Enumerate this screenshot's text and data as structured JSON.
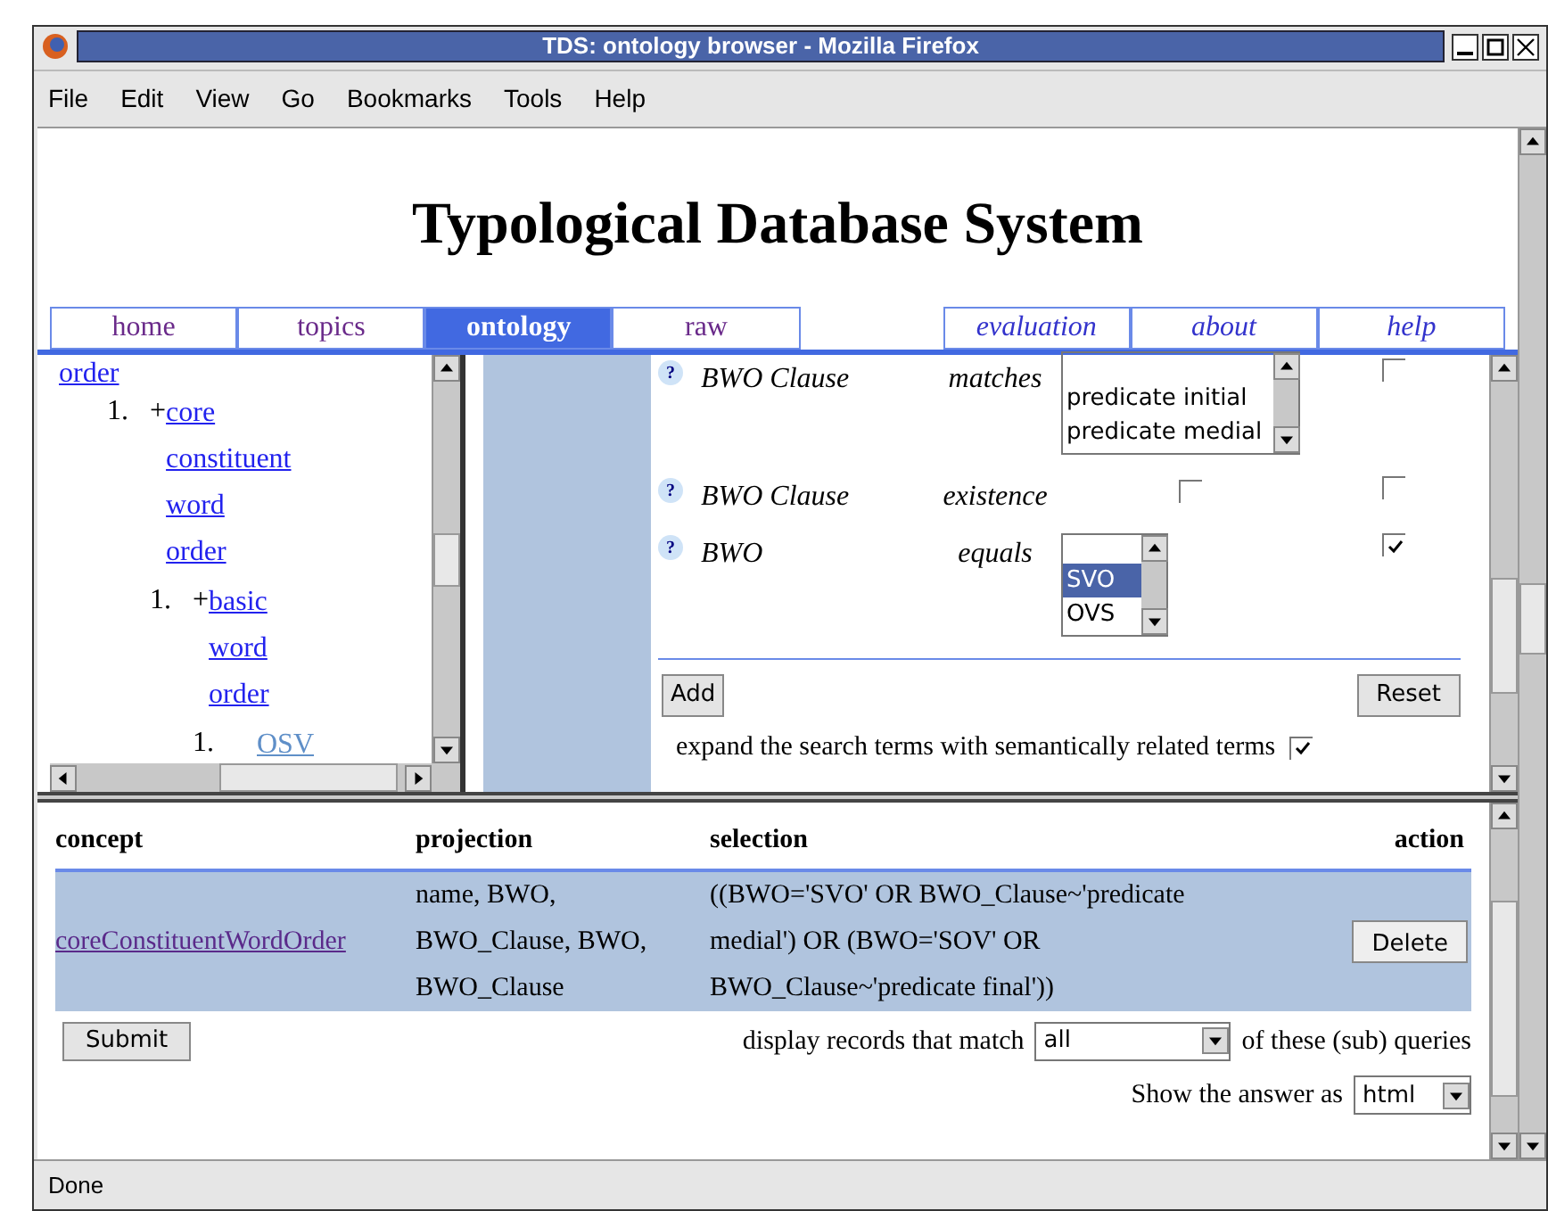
{
  "window": {
    "title": "TDS: ontology browser - Mozilla Firefox"
  },
  "menu": [
    {
      "label": "File"
    },
    {
      "label": "Edit"
    },
    {
      "label": "View"
    },
    {
      "label": "Go"
    },
    {
      "label": "Bookmarks"
    },
    {
      "label": "Tools"
    },
    {
      "label": "Help"
    }
  ],
  "heading": "Typological Database System",
  "tabs": [
    {
      "label": "home",
      "selected": false,
      "italic": false
    },
    {
      "label": "topics",
      "selected": false,
      "italic": false
    },
    {
      "label": "ontology",
      "selected": true,
      "italic": false
    },
    {
      "label": "raw",
      "selected": false,
      "italic": false
    },
    {
      "label": "evaluation",
      "selected": false,
      "italic": true
    },
    {
      "label": "about",
      "selected": false,
      "italic": true
    },
    {
      "label": "help",
      "selected": false,
      "italic": true
    }
  ],
  "tree": {
    "top_label": "order",
    "items": [
      {
        "number": "1.",
        "prefix": "+",
        "label": "core constituent word order",
        "visited": false,
        "children": [
          {
            "number": "1.",
            "prefix": "+",
            "label": "basic word order",
            "visited": false,
            "children": [
              {
                "number": "1.",
                "label": "OSV",
                "visited": true
              }
            ]
          }
        ]
      }
    ]
  },
  "query_rows": [
    {
      "help_icon": "?",
      "attribute": "BWO Clause",
      "operator": "matches",
      "kind": "listbox",
      "options": [
        {
          "label": "predicate initial",
          "selected": false
        },
        {
          "label": "predicate medial",
          "selected": false
        }
      ],
      "checked": false
    },
    {
      "help_icon": "?",
      "attribute": "BWO Clause",
      "operator": "existence",
      "kind": "checkbox",
      "exists": false,
      "checked": false
    },
    {
      "help_icon": "?",
      "attribute": "BWO",
      "operator": "equals",
      "kind": "listbox",
      "options": [
        {
          "label": "SVO",
          "selected": true
        },
        {
          "label": "OVS",
          "selected": false
        }
      ],
      "checked": true
    }
  ],
  "buttons": {
    "add": "Add",
    "reset": "Reset"
  },
  "expand": {
    "label": "expand the search terms with semantically related terms",
    "checked": true
  },
  "table": {
    "columns": [
      "concept",
      "projection",
      "selection",
      "action"
    ],
    "rows": [
      {
        "concept": "coreConstituentWordOrder",
        "projection": "name, BWO, BWO_Clause, BWO, BWO_Clause",
        "selection": "((BWO='SVO' OR BWO_Clause~'predicate medial') OR (BWO='SOV' OR BWO_Clause~'predicate final'))",
        "action": "Delete"
      }
    ]
  },
  "submit": "Submit",
  "match": {
    "before": "display records that match",
    "value": "all",
    "after": "of these (sub) queries"
  },
  "answer": {
    "label": "Show the answer as",
    "value": "html"
  },
  "status_bar": "Done"
}
